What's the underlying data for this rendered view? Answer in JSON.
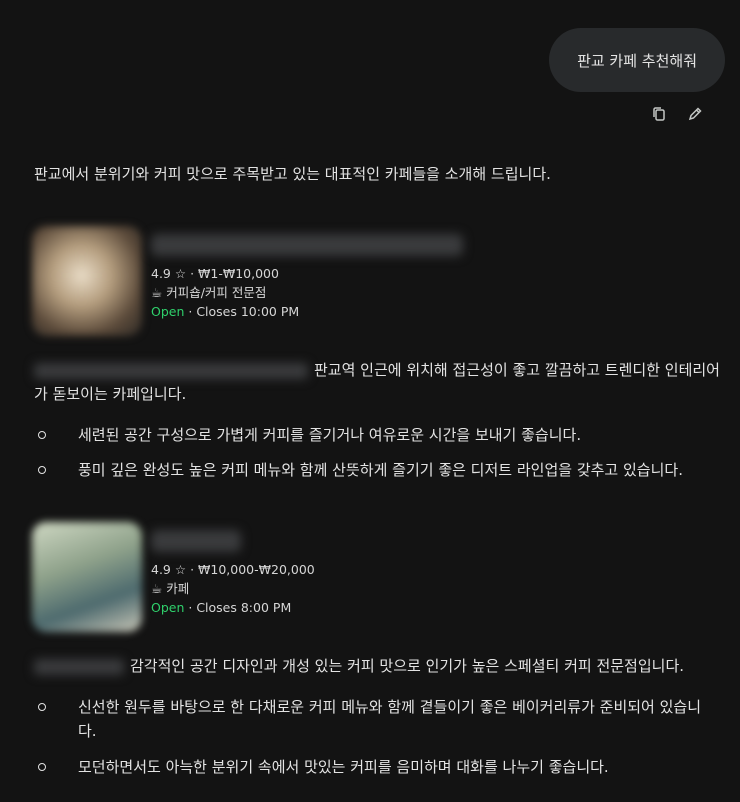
{
  "user_message": "판교 카페 추천해줘",
  "actions": {
    "copy_icon": "copy-icon",
    "edit_icon": "pencil-icon"
  },
  "response": {
    "intro": "판교에서 분위기와 커피 맛으로 주목받고 있는 대표적인 카페들을 소개해 드립니다.",
    "places": [
      {
        "rating": "4.9",
        "star": "☆",
        "price": "· ₩1-₩10,000",
        "category_icon": "☕",
        "category": "커피숍/커피 전문점",
        "status": "Open",
        "hours": "· Closes 10:00 PM",
        "description": "판교역 인근에 위치해 접근성이 좋고 깔끔하고 트렌디한 인테리어가 돋보이는 카페입니다.",
        "bullets": [
          "세련된 공간 구성으로 가볍게 커피를 즐기거나 여유로운 시간을 보내기 좋습니다.",
          "풍미 깊은 완성도 높은 커피 메뉴와 함께 산뜻하게 즐기기 좋은 디저트 라인업을 갖추고 있습니다."
        ]
      },
      {
        "rating": "4.9",
        "star": "☆",
        "price": "· ₩10,000-₩20,000",
        "category_icon": "☕",
        "category": "카페",
        "status": "Open",
        "hours": "· Closes 8:00 PM",
        "description": "감각적인 공간 디자인과 개성 있는 커피 맛으로 인기가 높은 스페셜티 커피 전문점입니다.",
        "bullets": [
          "신선한 원두를 바탕으로 한 다채로운 커피 메뉴와 함께 곁들이기 좋은 베이커리류가 준비되어 있습니다.",
          "모던하면서도 아늑한 분위기 속에서 맛있는 커피를 음미하며 대화를 나누기 좋습니다."
        ]
      }
    ]
  },
  "colors": {
    "background": "#131313",
    "bubble": "#282a2c",
    "open": "#2fd06b",
    "text": "#e3e3e3"
  }
}
